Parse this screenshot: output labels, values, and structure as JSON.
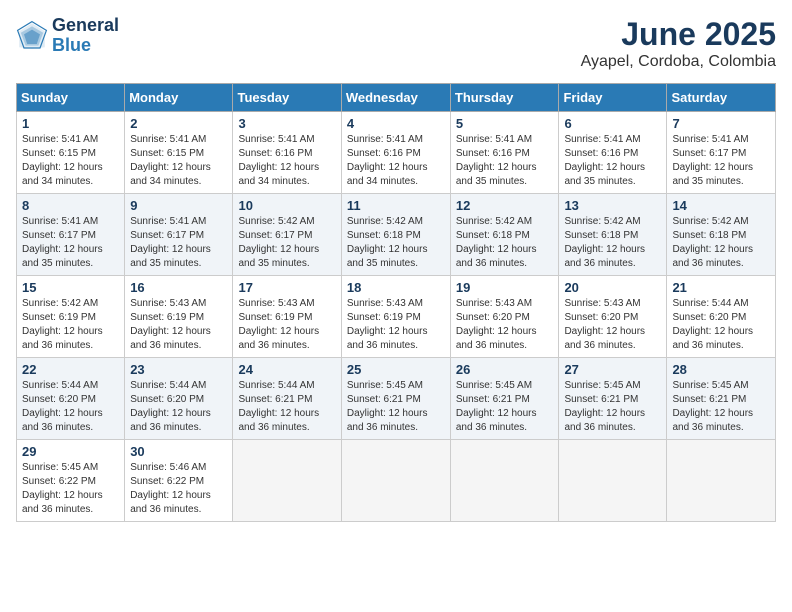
{
  "logo": {
    "line1": "General",
    "line2": "Blue"
  },
  "title": "June 2025",
  "location": "Ayapel, Cordoba, Colombia",
  "weekdays": [
    "Sunday",
    "Monday",
    "Tuesday",
    "Wednesday",
    "Thursday",
    "Friday",
    "Saturday"
  ],
  "weeks": [
    [
      {
        "day": "1",
        "info": "Sunrise: 5:41 AM\nSunset: 6:15 PM\nDaylight: 12 hours\nand 34 minutes."
      },
      {
        "day": "2",
        "info": "Sunrise: 5:41 AM\nSunset: 6:15 PM\nDaylight: 12 hours\nand 34 minutes."
      },
      {
        "day": "3",
        "info": "Sunrise: 5:41 AM\nSunset: 6:16 PM\nDaylight: 12 hours\nand 34 minutes."
      },
      {
        "day": "4",
        "info": "Sunrise: 5:41 AM\nSunset: 6:16 PM\nDaylight: 12 hours\nand 34 minutes."
      },
      {
        "day": "5",
        "info": "Sunrise: 5:41 AM\nSunset: 6:16 PM\nDaylight: 12 hours\nand 35 minutes."
      },
      {
        "day": "6",
        "info": "Sunrise: 5:41 AM\nSunset: 6:16 PM\nDaylight: 12 hours\nand 35 minutes."
      },
      {
        "day": "7",
        "info": "Sunrise: 5:41 AM\nSunset: 6:17 PM\nDaylight: 12 hours\nand 35 minutes."
      }
    ],
    [
      {
        "day": "8",
        "info": "Sunrise: 5:41 AM\nSunset: 6:17 PM\nDaylight: 12 hours\nand 35 minutes."
      },
      {
        "day": "9",
        "info": "Sunrise: 5:41 AM\nSunset: 6:17 PM\nDaylight: 12 hours\nand 35 minutes."
      },
      {
        "day": "10",
        "info": "Sunrise: 5:42 AM\nSunset: 6:17 PM\nDaylight: 12 hours\nand 35 minutes."
      },
      {
        "day": "11",
        "info": "Sunrise: 5:42 AM\nSunset: 6:18 PM\nDaylight: 12 hours\nand 35 minutes."
      },
      {
        "day": "12",
        "info": "Sunrise: 5:42 AM\nSunset: 6:18 PM\nDaylight: 12 hours\nand 36 minutes."
      },
      {
        "day": "13",
        "info": "Sunrise: 5:42 AM\nSunset: 6:18 PM\nDaylight: 12 hours\nand 36 minutes."
      },
      {
        "day": "14",
        "info": "Sunrise: 5:42 AM\nSunset: 6:18 PM\nDaylight: 12 hours\nand 36 minutes."
      }
    ],
    [
      {
        "day": "15",
        "info": "Sunrise: 5:42 AM\nSunset: 6:19 PM\nDaylight: 12 hours\nand 36 minutes."
      },
      {
        "day": "16",
        "info": "Sunrise: 5:43 AM\nSunset: 6:19 PM\nDaylight: 12 hours\nand 36 minutes."
      },
      {
        "day": "17",
        "info": "Sunrise: 5:43 AM\nSunset: 6:19 PM\nDaylight: 12 hours\nand 36 minutes."
      },
      {
        "day": "18",
        "info": "Sunrise: 5:43 AM\nSunset: 6:19 PM\nDaylight: 12 hours\nand 36 minutes."
      },
      {
        "day": "19",
        "info": "Sunrise: 5:43 AM\nSunset: 6:20 PM\nDaylight: 12 hours\nand 36 minutes."
      },
      {
        "day": "20",
        "info": "Sunrise: 5:43 AM\nSunset: 6:20 PM\nDaylight: 12 hours\nand 36 minutes."
      },
      {
        "day": "21",
        "info": "Sunrise: 5:44 AM\nSunset: 6:20 PM\nDaylight: 12 hours\nand 36 minutes."
      }
    ],
    [
      {
        "day": "22",
        "info": "Sunrise: 5:44 AM\nSunset: 6:20 PM\nDaylight: 12 hours\nand 36 minutes."
      },
      {
        "day": "23",
        "info": "Sunrise: 5:44 AM\nSunset: 6:20 PM\nDaylight: 12 hours\nand 36 minutes."
      },
      {
        "day": "24",
        "info": "Sunrise: 5:44 AM\nSunset: 6:21 PM\nDaylight: 12 hours\nand 36 minutes."
      },
      {
        "day": "25",
        "info": "Sunrise: 5:45 AM\nSunset: 6:21 PM\nDaylight: 12 hours\nand 36 minutes."
      },
      {
        "day": "26",
        "info": "Sunrise: 5:45 AM\nSunset: 6:21 PM\nDaylight: 12 hours\nand 36 minutes."
      },
      {
        "day": "27",
        "info": "Sunrise: 5:45 AM\nSunset: 6:21 PM\nDaylight: 12 hours\nand 36 minutes."
      },
      {
        "day": "28",
        "info": "Sunrise: 5:45 AM\nSunset: 6:21 PM\nDaylight: 12 hours\nand 36 minutes."
      }
    ],
    [
      {
        "day": "29",
        "info": "Sunrise: 5:45 AM\nSunset: 6:22 PM\nDaylight: 12 hours\nand 36 minutes."
      },
      {
        "day": "30",
        "info": "Sunrise: 5:46 AM\nSunset: 6:22 PM\nDaylight: 12 hours\nand 36 minutes."
      },
      {
        "day": "",
        "info": ""
      },
      {
        "day": "",
        "info": ""
      },
      {
        "day": "",
        "info": ""
      },
      {
        "day": "",
        "info": ""
      },
      {
        "day": "",
        "info": ""
      }
    ]
  ]
}
